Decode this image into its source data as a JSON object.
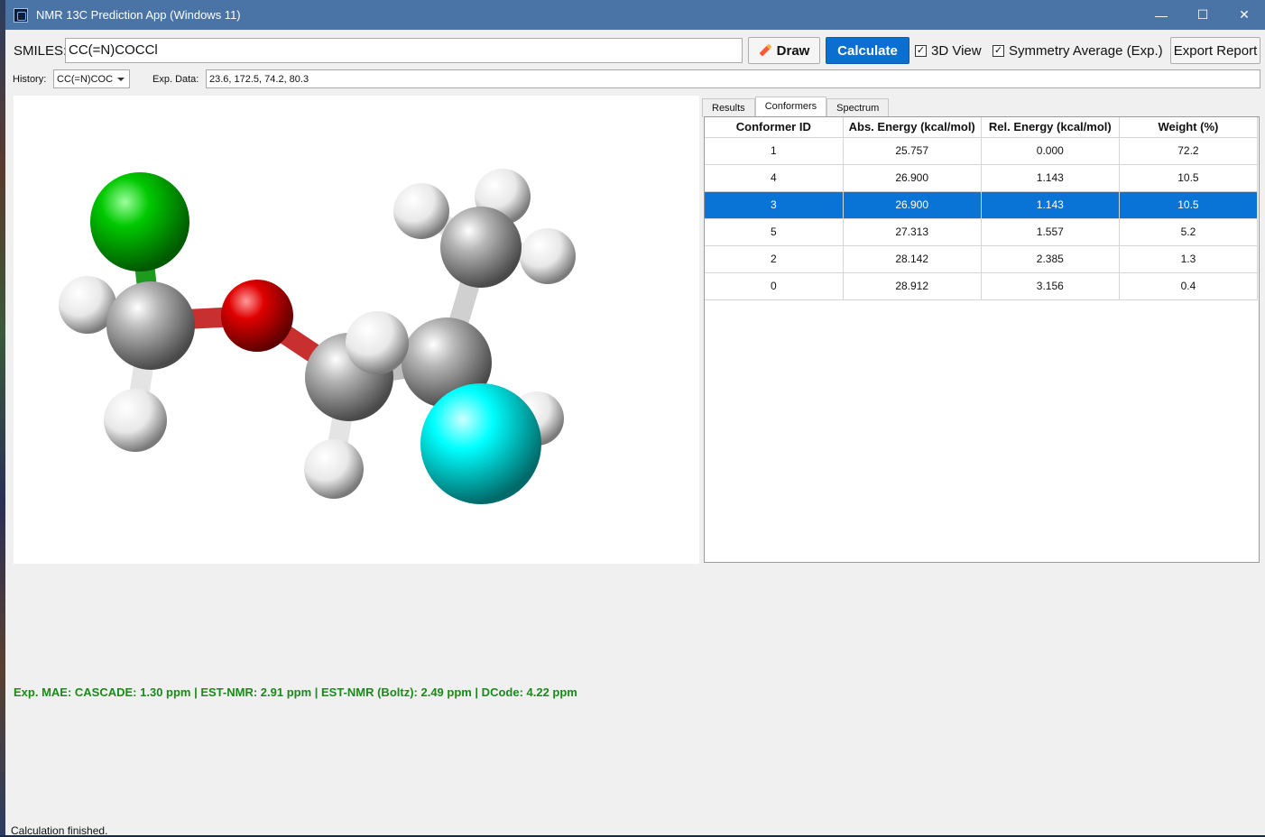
{
  "window": {
    "title": "NMR 13C Prediction App (Windows 11)",
    "controls": {
      "minimize": "—",
      "maximize": "☐",
      "close": "✕"
    }
  },
  "toolbar": {
    "smiles_label": "SMILES:",
    "smiles_value": "CC(=N)COCCl",
    "draw_label": "Draw",
    "calculate_label": "Calculate",
    "view3d_label": "3D View",
    "view3d_checked": true,
    "symmetry_label": "Symmetry Average (Exp.)",
    "symmetry_checked": true,
    "export_label": "Export Report",
    "check_mark": "✓"
  },
  "row2": {
    "history_label": "History:",
    "history_value": "CC(=N)COC",
    "exp_label": "Exp. Data:",
    "exp_value": "23.6, 172.5, 74.2, 80.3"
  },
  "tabs": [
    {
      "label": "Results",
      "active": false
    },
    {
      "label": "Conformers",
      "active": true
    },
    {
      "label": "Spectrum",
      "active": false
    }
  ],
  "conformers": {
    "headers": [
      "Conformer ID",
      "Abs. Energy (kcal/mol)",
      "Rel. Energy (kcal/mol)",
      "Weight (%)"
    ],
    "rows": [
      [
        "1",
        "25.757",
        "0.000",
        "72.2"
      ],
      [
        "4",
        "26.900",
        "1.143",
        "10.5"
      ],
      [
        "3",
        "26.900",
        "1.143",
        "10.5"
      ],
      [
        "5",
        "27.313",
        "1.557",
        "5.2"
      ],
      [
        "2",
        "28.142",
        "2.385",
        "1.3"
      ],
      [
        "0",
        "28.912",
        "3.156",
        "0.4"
      ]
    ],
    "selected_row": 2
  },
  "molecule_colors": {
    "chlorine": "#00c800",
    "oxygen": "#e00000",
    "carbon": "#a8a8a8",
    "hydrogen": "#f2f2f2",
    "nitrogen": "#00ffff"
  },
  "mae_text": "Exp. MAE: CASCADE: 1.30 ppm | EST-NMR: 2.91 ppm | EST-NMR (Boltz): 2.49 ppm | DCode: 4.22 ppm",
  "status_text": "Calculation finished."
}
